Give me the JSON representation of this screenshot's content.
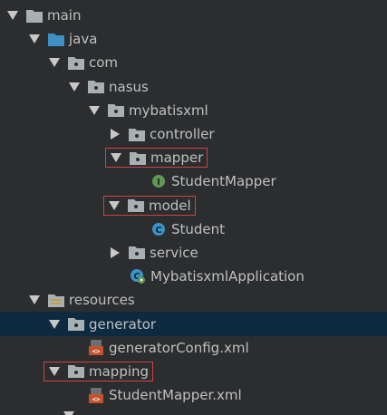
{
  "tree": {
    "main": "main",
    "java": "java",
    "com": "com",
    "nasus": "nasus",
    "mybatisxml": "mybatisxml",
    "controller": "controller",
    "mapper": "mapper",
    "student_mapper": "StudentMapper",
    "model": "model",
    "student": "Student",
    "service": "service",
    "application": "MybatisxmlApplication",
    "resources": "resources",
    "generator": "generator",
    "generator_config": "generatorConfig.xml",
    "mapping": "mapping",
    "student_mapper_xml": "StudentMapper.xml"
  },
  "icons": {
    "interface_letter": "I",
    "class_letter": "C",
    "xml_letter": "<>"
  },
  "colors": {
    "background": "#2b2d2f",
    "selected_row": "#0e2a40",
    "highlight_border": "#d0423f",
    "folder": "#a9b0b4",
    "source_folder": "#3d8fc6",
    "interface": "#629755",
    "class": "#3a93c9",
    "xml": "#c4532d"
  }
}
